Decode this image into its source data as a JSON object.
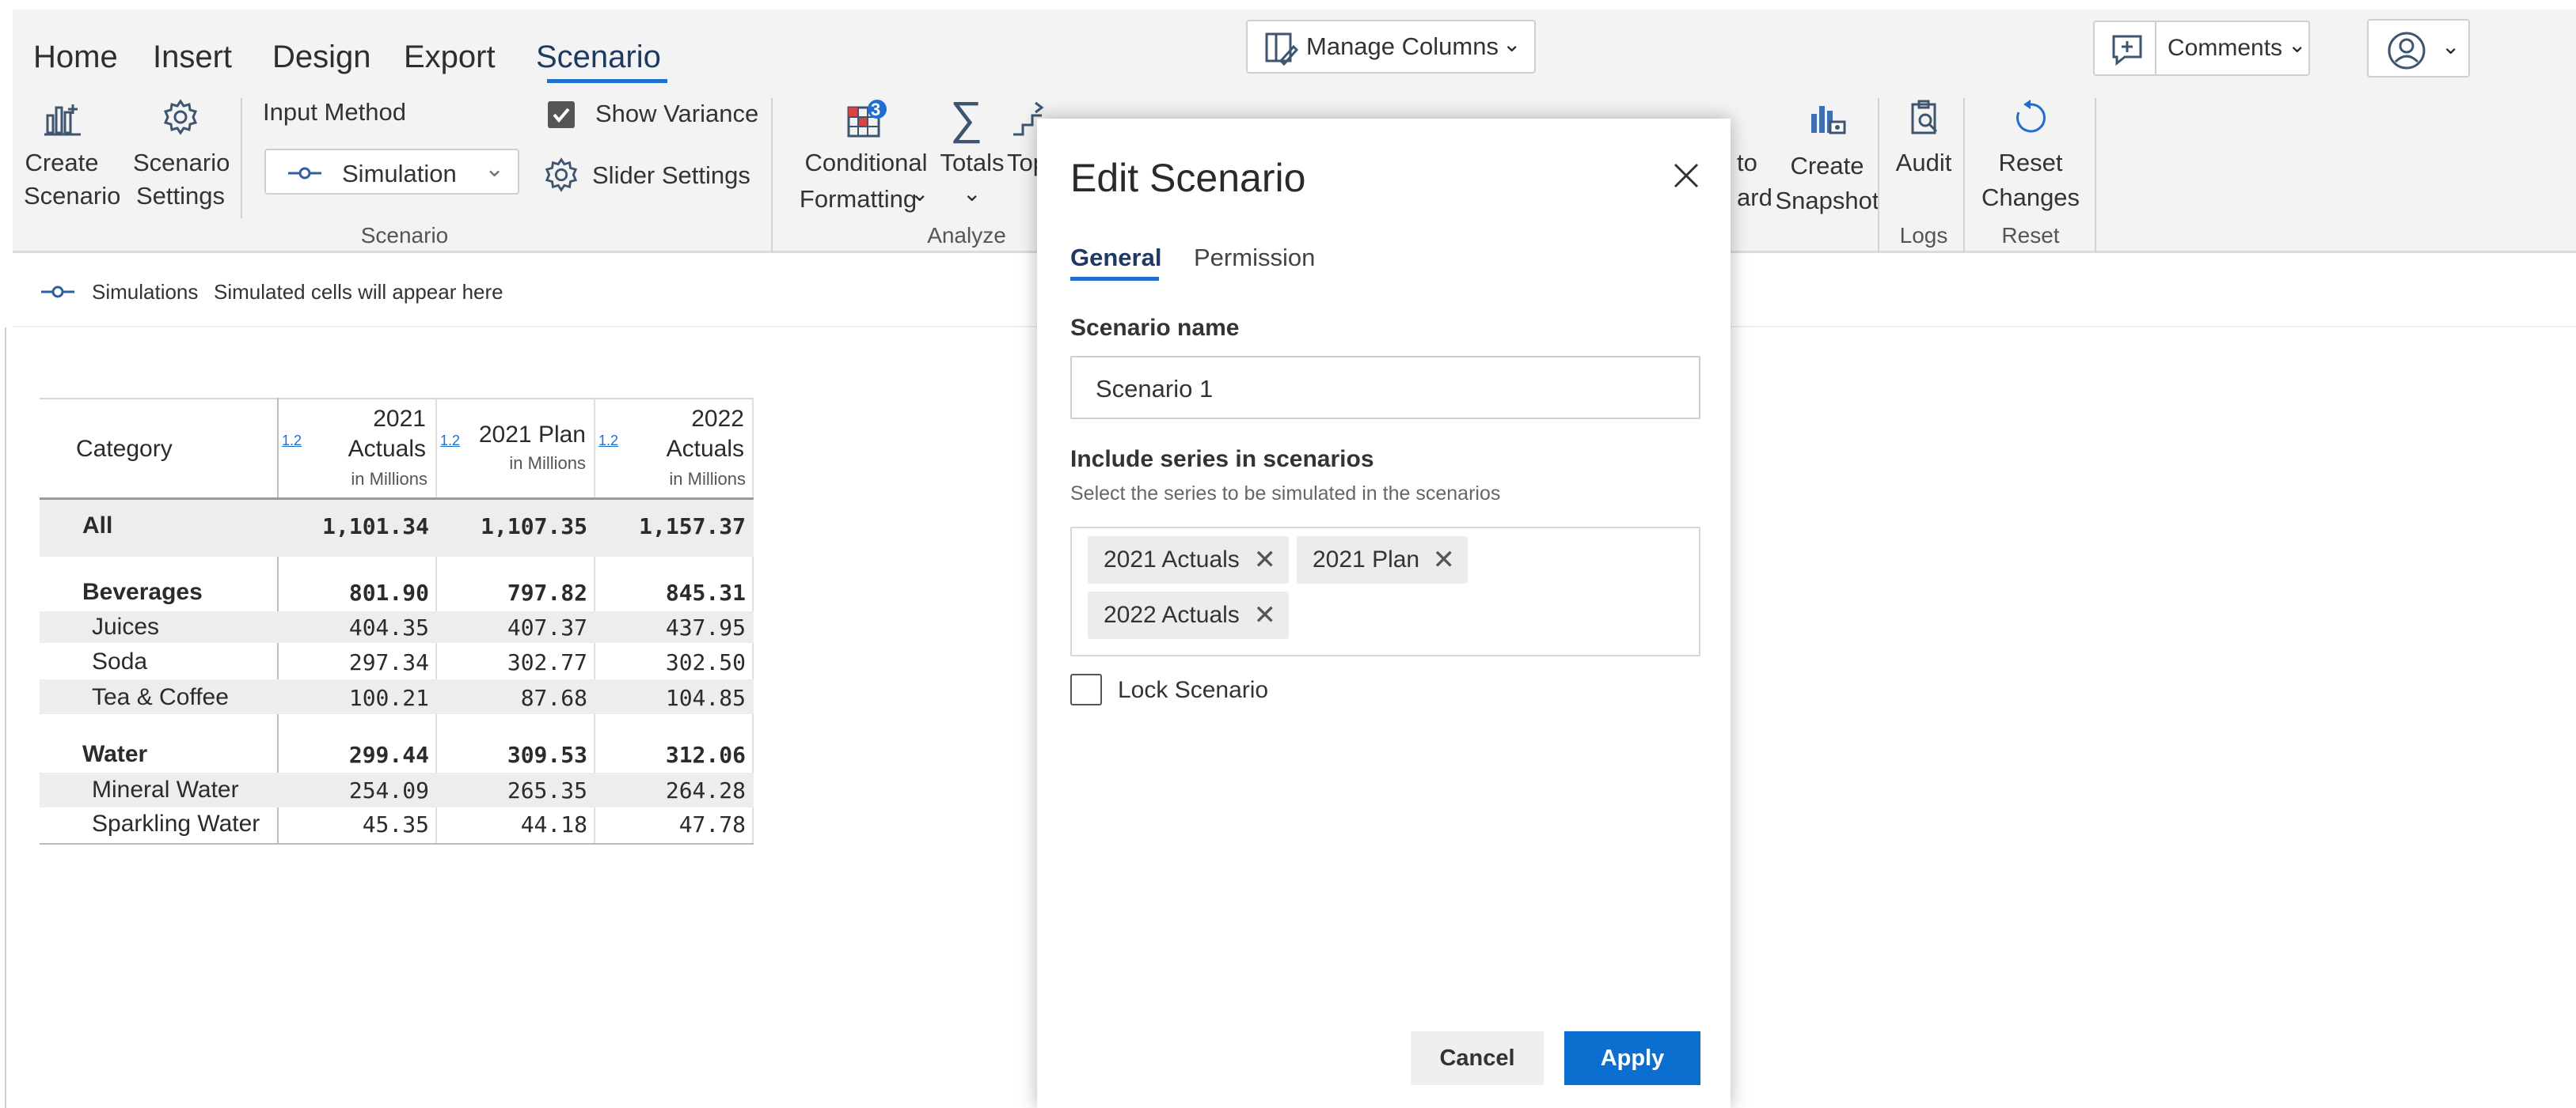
{
  "menu": {
    "tabs": [
      "Home",
      "Insert",
      "Design",
      "Export",
      "Scenario"
    ],
    "active": "Scenario",
    "manage_columns": "Manage Columns",
    "comments": "Comments"
  },
  "ribbon": {
    "create_scenario": [
      "Create",
      "Scenario"
    ],
    "scenario_settings": [
      "Scenario",
      "Settings"
    ],
    "input_method_label": "Input Method",
    "input_method_value": "Simulation",
    "show_variance": "Show Variance",
    "show_variance_checked": true,
    "slider_settings": "Slider Settings",
    "scenario_group": "Scenario",
    "conditional_formatting": [
      "Conditional",
      "Formatting"
    ],
    "conditional_badge": "3",
    "totals": "Totals",
    "top_partial": "Top",
    "analyze_group": "Analyze",
    "rd_partial": [
      "to",
      "ard"
    ],
    "create_snapshot": [
      "Create",
      "Snapshot"
    ],
    "audit": "Audit",
    "logs_group": "Logs",
    "reset_changes": [
      "Reset",
      "Changes"
    ],
    "reset_group": "Reset"
  },
  "status": {
    "simulations": "Simulations",
    "hint": "Simulated cells will appear here"
  },
  "table": {
    "header": {
      "category": "Category",
      "cols": [
        {
          "title": [
            "2021",
            "Actuals"
          ],
          "unit": "in Millions",
          "badge": "1.2"
        },
        {
          "title": [
            "2021 Plan"
          ],
          "unit": "in Millions",
          "badge": "1.2"
        },
        {
          "title": [
            "2022",
            "Actuals"
          ],
          "unit": "in Millions",
          "badge": "1.2"
        }
      ]
    },
    "rows": [
      {
        "label": "All",
        "values": [
          "1,101.34",
          "1,107.35",
          "1,157.37"
        ],
        "bold": true
      },
      {
        "label": "Beverages",
        "values": [
          "801.90",
          "797.82",
          "845.31"
        ],
        "bold": true
      },
      {
        "label": "Juices",
        "values": [
          "404.35",
          "407.37",
          "437.95"
        ],
        "bold": false
      },
      {
        "label": "Soda",
        "values": [
          "297.34",
          "302.77",
          "302.50"
        ],
        "bold": false
      },
      {
        "label": "Tea & Coffee",
        "values": [
          "100.21",
          "87.68",
          "104.85"
        ],
        "bold": false
      },
      {
        "label": "Water",
        "values": [
          "299.44",
          "309.53",
          "312.06"
        ],
        "bold": true
      },
      {
        "label": "Mineral Water",
        "values": [
          "254.09",
          "265.35",
          "264.28"
        ],
        "bold": false
      },
      {
        "label": "Sparkling Water",
        "values": [
          "45.35",
          "44.18",
          "47.78"
        ],
        "bold": false
      }
    ]
  },
  "dialog": {
    "title": "Edit Scenario",
    "tabs": [
      "General",
      "Permission"
    ],
    "active_tab": "General",
    "name_label": "Scenario name",
    "name_value": "Scenario 1",
    "series_label": "Include series in scenarios",
    "series_hint": "Select the series to be simulated in the scenarios",
    "series": [
      "2021 Actuals",
      "2021 Plan",
      "2022 Actuals"
    ],
    "lock_label": "Lock Scenario",
    "lock_checked": false,
    "cancel": "Cancel",
    "apply": "Apply"
  },
  "colors": {
    "accent": "#0b6fd0",
    "tab_underline": "#1f6fd1",
    "ribbon_bg": "#f3f3f3",
    "band": "#ededed"
  }
}
